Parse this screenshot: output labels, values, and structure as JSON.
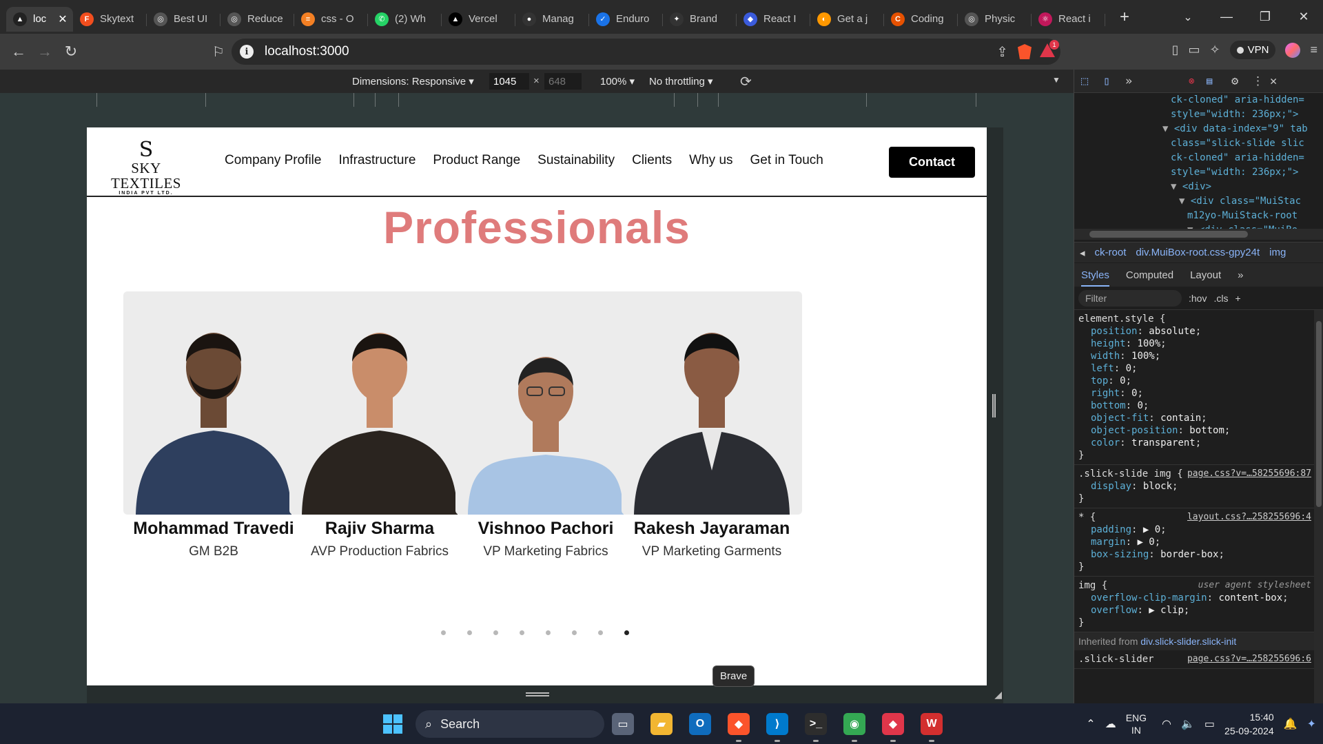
{
  "browser": {
    "tabs": [
      {
        "title": "loc",
        "color": "#222222",
        "glyph": "▲",
        "active": true
      },
      {
        "title": "Skytext",
        "color": "#f24e1e",
        "glyph": "F"
      },
      {
        "title": "Best UI",
        "color": "#555555",
        "glyph": "◎"
      },
      {
        "title": "Reduce",
        "color": "#555555",
        "glyph": "◎"
      },
      {
        "title": "css - O",
        "color": "#f48024",
        "glyph": "≡"
      },
      {
        "title": "(2) Wh",
        "color": "#25d366",
        "glyph": "✆"
      },
      {
        "title": "Vercel",
        "color": "#000000",
        "glyph": "▲"
      },
      {
        "title": "Manag",
        "color": "#333333",
        "glyph": "●"
      },
      {
        "title": "Enduro",
        "color": "#1a73e8",
        "glyph": "✓"
      },
      {
        "title": "Brand",
        "color": "#333333",
        "glyph": "✦"
      },
      {
        "title": "React I",
        "color": "#3b5bdb",
        "glyph": "◆"
      },
      {
        "title": "Get a j",
        "color": "#ff9800",
        "glyph": "◐"
      },
      {
        "title": "Coding",
        "color": "#e65100",
        "glyph": "C"
      },
      {
        "title": "Physic",
        "color": "#555555",
        "glyph": "◎"
      },
      {
        "title": "React i",
        "color": "#c2185b",
        "glyph": "⚛"
      }
    ],
    "close_label": "✕",
    "new_tab_label": "+",
    "url": "localhost:3000",
    "vpn_label": "VPN",
    "rewards_badge": "1",
    "device_toolbar": {
      "dimensions_label": "Dimensions: Responsive ▾",
      "width": "1045",
      "height": "648",
      "times": "×",
      "zoom": "100% ▾",
      "throttling": "No throttling ▾"
    },
    "tooltip": "Brave"
  },
  "site": {
    "logo": {
      "mark": "S",
      "name": "SKY TEXTILES",
      "sub": "INDIA PVT LTD."
    },
    "nav": [
      "Company Profile",
      "Infrastructure",
      "Product Range",
      "Sustainability",
      "Clients",
      "Why us",
      "Get in Touch"
    ],
    "contact_label": "Contact",
    "heading": "Professionals",
    "heading_color": "#df7b7b",
    "people": [
      {
        "name": "Mohammad Travedi",
        "role": "GM B2B",
        "shirt": "#2e3f5e",
        "skin": "#6b4a35",
        "hair": "#1a1410"
      },
      {
        "name": "Rajiv Sharma",
        "role": "AVP Production Fabrics",
        "shirt": "#2a241f",
        "skin": "#c98d6a",
        "hair": "#1a1410"
      },
      {
        "name": "Vishnoo Pachori",
        "role": "VP Marketing Fabrics",
        "shirt": "#a8c4e4",
        "skin": "#b07a5c",
        "hair": "#222222"
      },
      {
        "name": "Rakesh Jayaraman",
        "role": "VP Marketing Garments",
        "shirt": "#2b2d33",
        "skin": "#8a5b43",
        "hair": "#111111"
      }
    ],
    "carousel_dots": 8,
    "active_dot": 7
  },
  "devtools": {
    "dom_lines": [
      [
        "",
        "ck-cloned\" aria-hidden=",
        ""
      ],
      [
        "",
        "style=\"width: 236px;\">",
        ""
      ],
      [
        "▼ ",
        "<div data-index=\"9\" tab",
        ""
      ],
      [
        "",
        "class=\"slick-slide slic",
        ""
      ],
      [
        "",
        "ck-cloned\" aria-hidden=",
        ""
      ],
      [
        "",
        "style=\"width: 236px;\">",
        ""
      ],
      [
        "▼ ",
        "<div>",
        ""
      ],
      [
        "▼ ",
        "<div class=\"MuiStac",
        ""
      ],
      [
        "",
        "m12yo-MuiStack-root",
        ""
      ],
      [
        "▼ ",
        "<div class=\"MuiBo",
        ""
      ]
    ],
    "breadcrumbs": [
      "ck-root",
      "div.MuiBox-root.css-gpy24t",
      "img"
    ],
    "subtabs": [
      "Styles",
      "Computed",
      "Layout",
      "»"
    ],
    "filter_placeholder": "Filter",
    "filter_tools": [
      ":hov",
      ".cls",
      "+"
    ],
    "rules": [
      {
        "selector": "element.style {",
        "source": "",
        "decls": [
          [
            "position",
            "absolute"
          ],
          [
            "height",
            "100%"
          ],
          [
            "width",
            "100%"
          ],
          [
            "left",
            "0"
          ],
          [
            "top",
            "0"
          ],
          [
            "right",
            "0"
          ],
          [
            "bottom",
            "0"
          ],
          [
            "object-fit",
            "contain"
          ],
          [
            "object-position",
            "bottom"
          ],
          [
            "color",
            "transparent"
          ]
        ]
      },
      {
        "selector": ".slick-slide img {",
        "source": "page.css?v=…58255696:87",
        "decls": [
          [
            "display",
            "block"
          ]
        ]
      },
      {
        "selector": "* {",
        "source": "layout.css?…258255696:4",
        "decls": [
          [
            "padding",
            "▶ 0"
          ],
          [
            "margin",
            "▶ 0"
          ],
          [
            "box-sizing",
            "border-box"
          ]
        ]
      },
      {
        "selector": "img {",
        "source": "user agent stylesheet",
        "decls": [
          [
            "overflow-clip-margin",
            "content-box"
          ],
          [
            "overflow",
            "▶ clip"
          ]
        ]
      }
    ],
    "inherited_label": "Inherited from",
    "inherited_from": "div.slick-slider.slick-init",
    "last_rule": {
      "selector": ".slick-slider",
      "source": "page.css?v=…258255696:6"
    }
  },
  "taskbar": {
    "search_label": "Search",
    "lang_top": "ENG",
    "lang_bottom": "IN",
    "time": "15:40",
    "date": "25-09-2024",
    "apps": [
      {
        "name": "task-view",
        "color": "#5a6478",
        "glyph": "▭",
        "left": 0
      },
      {
        "name": "file-explorer",
        "color": "#f2b632",
        "glyph": "▰",
        "left": 0
      },
      {
        "name": "outlook",
        "color": "#0f6cbd",
        "glyph": "O",
        "left": 0
      },
      {
        "name": "brave",
        "color": "#fb542b",
        "glyph": "◆",
        "left": 0
      },
      {
        "name": "vscode",
        "color": "#007acc",
        "glyph": "⟩",
        "left": 0
      },
      {
        "name": "terminal",
        "color": "#2d2d2d",
        "glyph": ">_",
        "left": 0
      },
      {
        "name": "chrome",
        "color": "#34a853",
        "glyph": "◉",
        "left": 0
      },
      {
        "name": "brave-beta",
        "color": "#e0364a",
        "glyph": "◆",
        "left": 0
      },
      {
        "name": "wps-office",
        "color": "#d32f2f",
        "glyph": "W",
        "left": 0
      }
    ]
  }
}
